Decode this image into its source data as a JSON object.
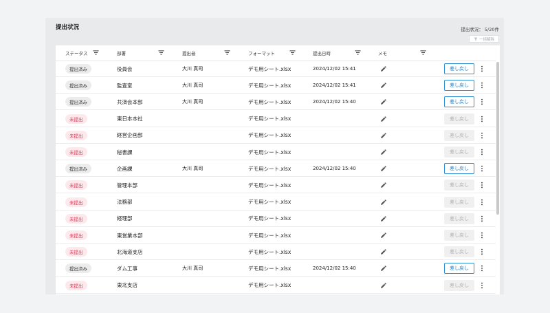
{
  "panel": {
    "title": "提出状況",
    "status_count": "提出状況： 5/20件",
    "bulk_clear_label": "一括解除"
  },
  "columns": [
    "ステータス",
    "部署",
    "提出者",
    "フォーマット",
    "提出日時",
    "メモ"
  ],
  "revert_label": "差し戻し",
  "colors": {
    "accent": "#2b8fd6",
    "pending_text": "#d23a57",
    "pending_bg": "#fde8ec",
    "done_bg": "#ececec"
  },
  "rows": [
    {
      "status": "提出済み",
      "submitted": true,
      "dept": "役員会",
      "submitter": "大川 真司",
      "format": "デモ用シート.xlsx",
      "date": "2024/12/02 15:41"
    },
    {
      "status": "提出済み",
      "submitted": true,
      "dept": "監査室",
      "submitter": "大川 真司",
      "format": "デモ用シート.xlsx",
      "date": "2024/12/02 15:41"
    },
    {
      "status": "提出済み",
      "submitted": true,
      "dept": "共済会本部",
      "submitter": "大川 真司",
      "format": "デモ用シート.xlsx",
      "date": "2024/12/02 15:40"
    },
    {
      "status": "未提出",
      "submitted": false,
      "dept": "東日本本社",
      "submitter": "",
      "format": "デモ用シート.xlsx",
      "date": ""
    },
    {
      "status": "未提出",
      "submitted": false,
      "dept": "経営企画部",
      "submitter": "",
      "format": "デモ用シート.xlsx",
      "date": ""
    },
    {
      "status": "未提出",
      "submitted": false,
      "dept": "秘書課",
      "submitter": "",
      "format": "デモ用シート.xlsx",
      "date": ""
    },
    {
      "status": "提出済み",
      "submitted": true,
      "dept": "企画課",
      "submitter": "大川 真司",
      "format": "デモ用シート.xlsx",
      "date": "2024/12/02 15:40"
    },
    {
      "status": "未提出",
      "submitted": false,
      "dept": "管理本部",
      "submitter": "",
      "format": "デモ用シート.xlsx",
      "date": ""
    },
    {
      "status": "未提出",
      "submitted": false,
      "dept": "法務部",
      "submitter": "",
      "format": "デモ用シート.xlsx",
      "date": ""
    },
    {
      "status": "未提出",
      "submitted": false,
      "dept": "経理部",
      "submitter": "",
      "format": "デモ用シート.xlsx",
      "date": ""
    },
    {
      "status": "未提出",
      "submitted": false,
      "dept": "東営業本部",
      "submitter": "",
      "format": "デモ用シート.xlsx",
      "date": ""
    },
    {
      "status": "未提出",
      "submitted": false,
      "dept": "北海道支店",
      "submitter": "",
      "format": "デモ用シート.xlsx",
      "date": ""
    },
    {
      "status": "提出済み",
      "submitted": true,
      "dept": "ダム工事",
      "submitter": "大川 真司",
      "format": "デモ用シート.xlsx",
      "date": "2024/12/02 15:40"
    },
    {
      "status": "未提出",
      "submitted": false,
      "dept": "東北支店",
      "submitter": "",
      "format": "デモ用シート.xlsx",
      "date": ""
    }
  ]
}
